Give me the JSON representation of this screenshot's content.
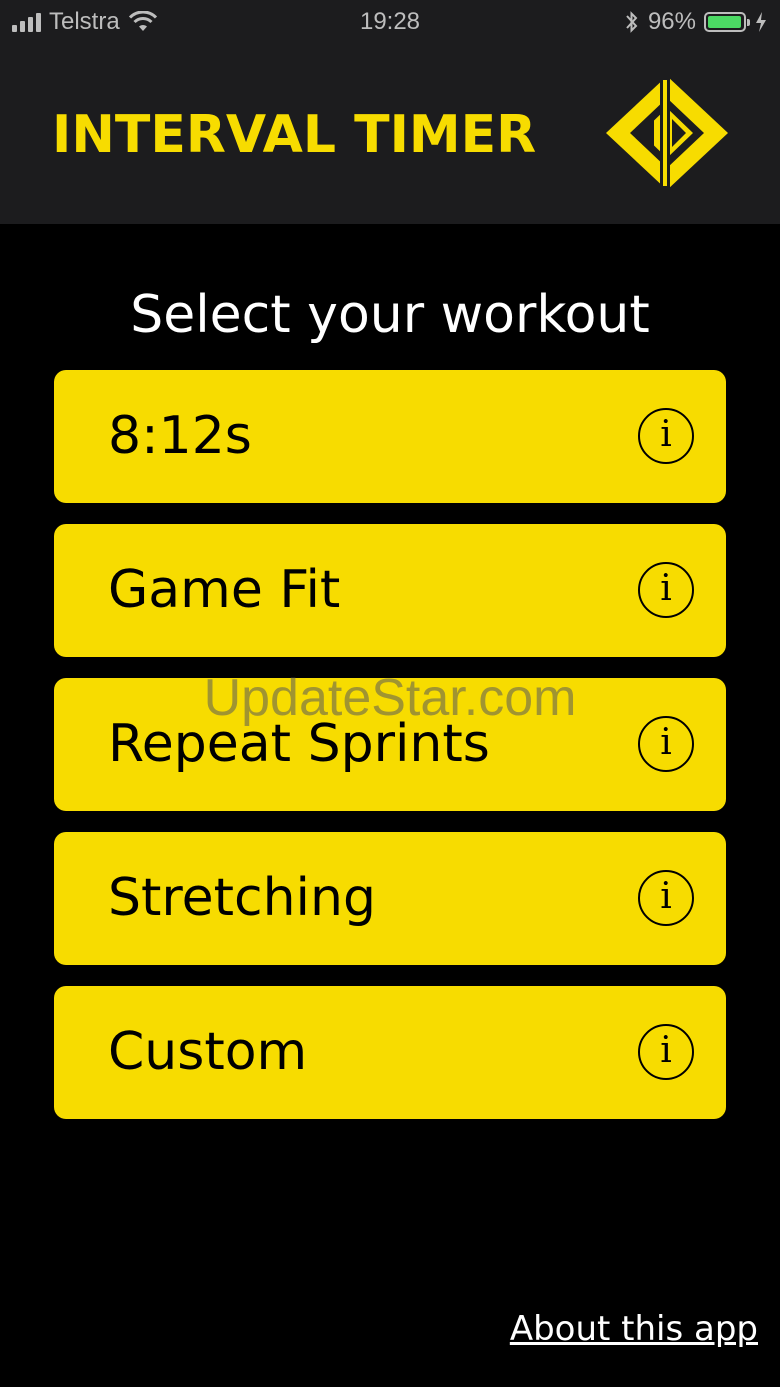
{
  "status_bar": {
    "carrier": "Telstra",
    "time": "19:28",
    "battery_percent": "96%",
    "battery_level": 0.96,
    "battery_color": "#4cd964"
  },
  "header": {
    "title": "INTERVAL TIMER",
    "logo_icon": "diamond-play-logo",
    "accent_color": "#f7dc00"
  },
  "main": {
    "heading": "Select your workout",
    "workouts": [
      {
        "label": "8:12s",
        "info_icon": "info-circle-icon",
        "info_glyph": "i"
      },
      {
        "label": "Game Fit",
        "info_icon": "info-circle-icon",
        "info_glyph": "i"
      },
      {
        "label": "Repeat Sprints",
        "info_icon": "info-circle-icon",
        "info_glyph": "i"
      },
      {
        "label": "Stretching",
        "info_icon": "info-circle-icon",
        "info_glyph": "i"
      },
      {
        "label": "Custom",
        "info_icon": "info-circle-icon",
        "info_glyph": "i"
      }
    ]
  },
  "footer": {
    "about_link": "About this app"
  },
  "watermark": "UpdateStar.com"
}
